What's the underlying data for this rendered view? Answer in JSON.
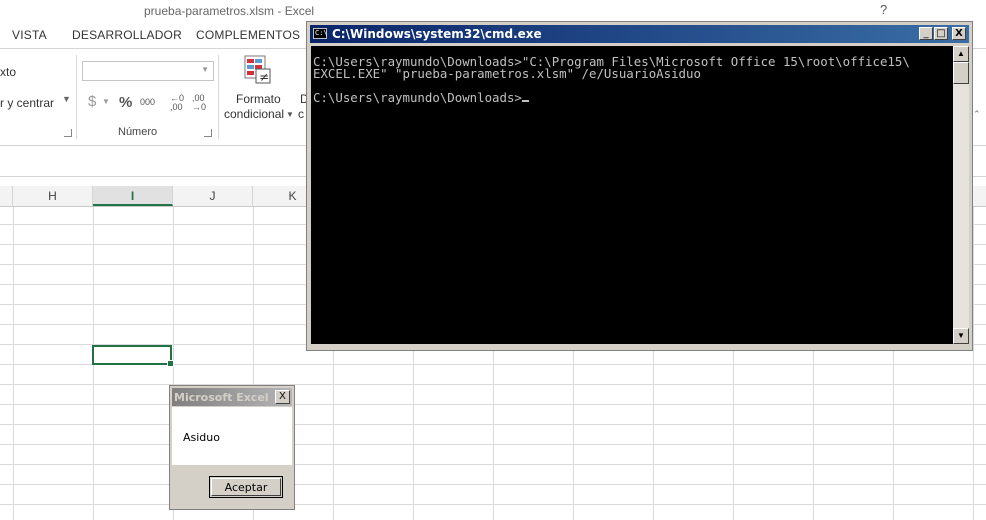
{
  "excel": {
    "window_title": "prueba-parametros.xlsm - Excel",
    "help_glyph": "?",
    "tabs": [
      "VISTA",
      "DESARROLLADOR",
      "COMPLEMENTOS"
    ],
    "ribbon": {
      "wrap_text_partial": "xto",
      "merge_center_partial": "r y centrar",
      "number_group_label": "Número",
      "number_format_value": "",
      "currency_symbol": "$",
      "percent_symbol": "%",
      "thousands_symbol": "000",
      "increase_decimal": "←0 ,00",
      "decrease_decimal": ",00 →0",
      "conditional_format_line1": "Formato",
      "conditional_format_line2": "condicional",
      "next_button_partial": "D",
      "next_button_partial2": "c"
    },
    "columns": [
      "H",
      "I",
      "J",
      "K"
    ],
    "active_column": "I"
  },
  "cmd": {
    "title": "C:\\Windows\\system32\\cmd.exe",
    "icon_text": "C:\\",
    "lines": [
      "C:\\Users\\raymundo\\Downloads>\"C:\\Program Files\\Microsoft Office 15\\root\\office15\\",
      "EXCEL.EXE\" \"prueba-parametros.xlsm\" /e/UsuarioAsiduo",
      "",
      "C:\\Users\\raymundo\\Downloads>"
    ],
    "btn_min": "_",
    "btn_max": "□",
    "btn_close": "X"
  },
  "msgbox": {
    "title": "Microsoft Excel",
    "message": "Asiduo",
    "ok_label": "Aceptar",
    "close_glyph": "X"
  }
}
